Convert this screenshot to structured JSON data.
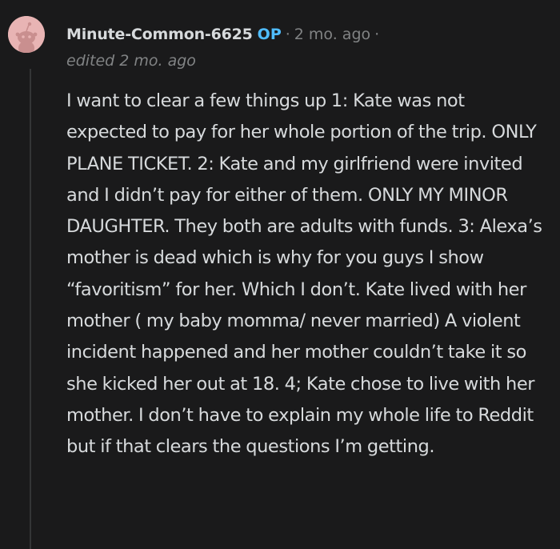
{
  "comment": {
    "author": "Minute-Common-6625",
    "op_badge": "OP",
    "separator_1": "·",
    "age": "2 mo. ago",
    "separator_2": "·",
    "edited": "edited 2 mo. ago",
    "body": "I want to clear a few things up 1: Kate was not expected to pay for her whole portion of the trip. ONLY PLANE TICKET. 2: Kate and my girlfriend were invited and I didn’t pay for either of them. ONLY MY MINOR DAUGHTER. They both are adults with funds. 3: Alexa’s mother is dead which is why for you guys I show “favoritism” for her. Which I don’t. Kate lived with her mother ( my baby momma/ never married) A violent incident happened and her mother couldn’t take it so she kicked her out at 18. 4; Kate chose to live with her mother. I don’t have to explain my whole life to Reddit but if that clears the questions I’m getting."
  },
  "colors": {
    "background": "#1a1a1b",
    "text": "#d7dadc",
    "muted": "#818384",
    "op_badge": "#4fbcff",
    "avatar_bg": "#e8b4b4"
  },
  "icons": {
    "avatar": "snoo-avatar-icon"
  }
}
